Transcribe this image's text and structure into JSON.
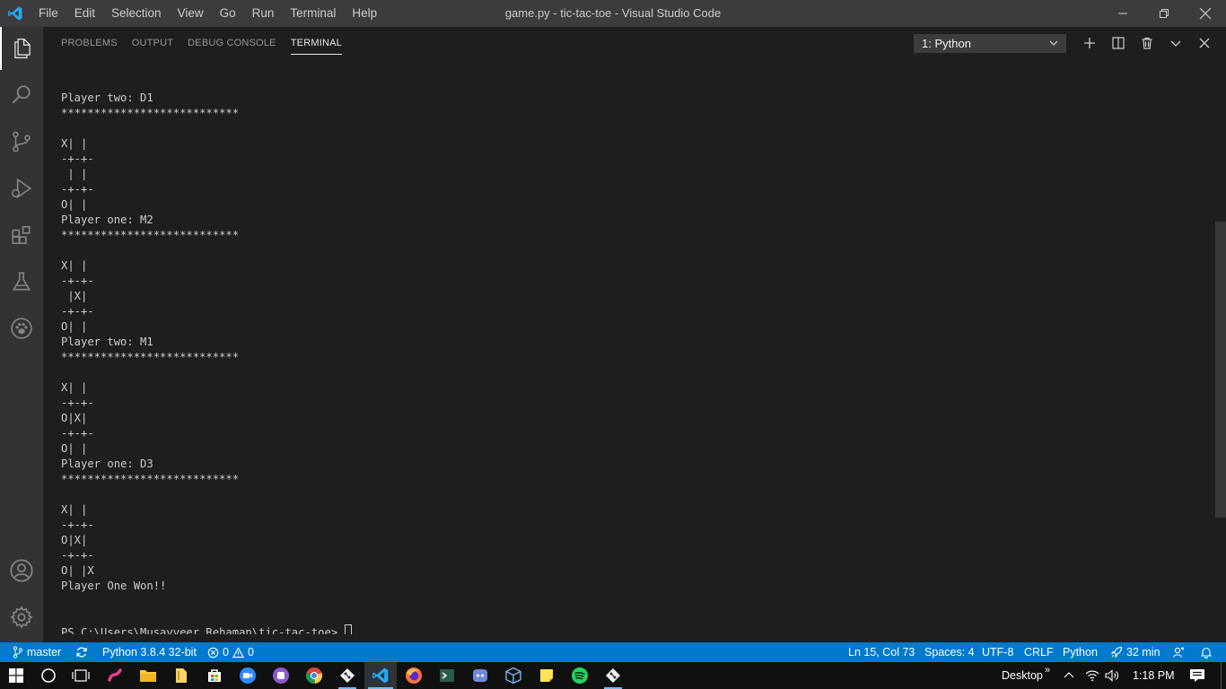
{
  "titlebar": {
    "menu": [
      "File",
      "Edit",
      "Selection",
      "View",
      "Go",
      "Run",
      "Terminal",
      "Help"
    ],
    "title": "game.py - tic-tac-toe - Visual Studio Code"
  },
  "activity_bar": {
    "icons": [
      "explorer-icon",
      "search-icon",
      "source-control-icon",
      "run-debug-icon",
      "extensions-icon",
      "testing-icon",
      "paw-icon",
      "account-icon",
      "settings-gear-icon"
    ]
  },
  "panel": {
    "tabs": [
      {
        "label": "PROBLEMS",
        "active": false
      },
      {
        "label": "OUTPUT",
        "active": false
      },
      {
        "label": "DEBUG CONSOLE",
        "active": false
      },
      {
        "label": "TERMINAL",
        "active": true
      }
    ],
    "terminal_select": "1: Python",
    "actions": [
      "plus-icon",
      "split-icon",
      "trash-icon",
      "chevron-down-icon",
      "close-icon"
    ]
  },
  "terminal": {
    "lines": [
      "Player two: D1",
      "***************************",
      "",
      "X| |",
      "-+-+-",
      " | |",
      "-+-+-",
      "O| |",
      "Player one: M2",
      "***************************",
      "",
      "X| |",
      "-+-+-",
      " |X|",
      "-+-+-",
      "O| |",
      "Player two: M1",
      "***************************",
      "",
      "X| |",
      "-+-+-",
      "O|X|",
      "-+-+-",
      "O| |",
      "Player one: D3",
      "***************************",
      "",
      "X| |",
      "-+-+-",
      "O|X|",
      "-+-+-",
      "O| |X",
      "Player One Won!!"
    ],
    "prompt": "PS C:\\Users\\Musavveer Rehaman\\tic-tac-toe> "
  },
  "statusbar": {
    "branch": "master",
    "interpreter": "Python 3.8.4 32-bit",
    "errors": "0",
    "warnings": "0",
    "position": "Ln 15, Col 73",
    "spaces": "Spaces: 4",
    "encoding": "UTF-8",
    "eol": "CRLF",
    "language": "Python",
    "timer": "32 min"
  },
  "taskbar": {
    "desktop_label": "Desktop",
    "time": "1:18 PM"
  },
  "colors": {
    "accent": "#007acc",
    "titlebar": "#3c3c3c",
    "activity": "#333333",
    "editor_bg": "#1e1e1e"
  }
}
